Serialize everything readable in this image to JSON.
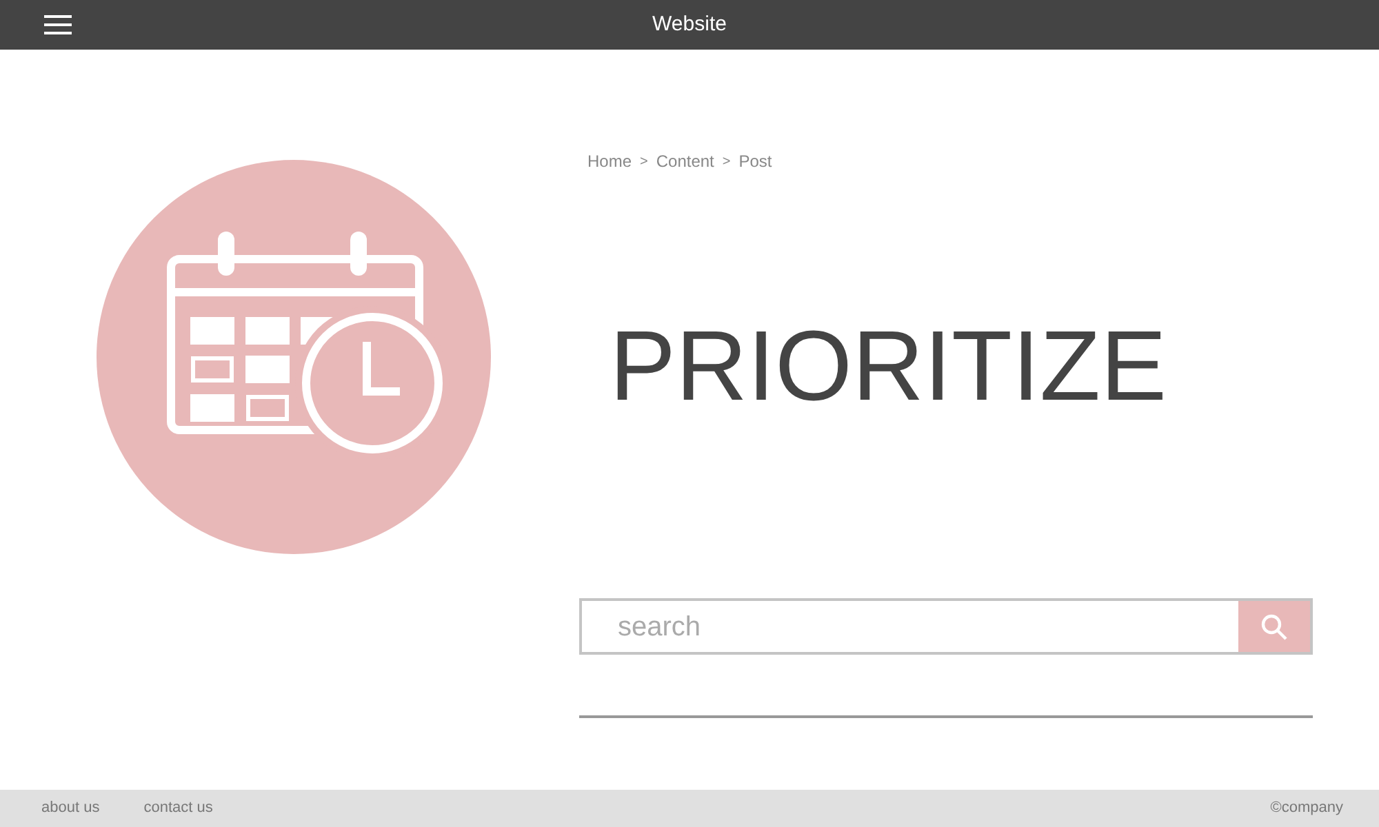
{
  "top_bar": {
    "title": "Website"
  },
  "breadcrumb": [
    {
      "kind": "link",
      "label": "Home"
    },
    {
      "kind": "separator",
      "label": ">"
    },
    {
      "kind": "link",
      "label": "Content"
    },
    {
      "kind": "separator",
      "label": ">"
    },
    {
      "kind": "link",
      "label": "Post"
    }
  ],
  "heading": "PRIORITIZE",
  "search": {
    "placeholder": "search"
  },
  "footer": {
    "links": [
      "about us",
      "contact us"
    ],
    "company": "©company"
  }
}
